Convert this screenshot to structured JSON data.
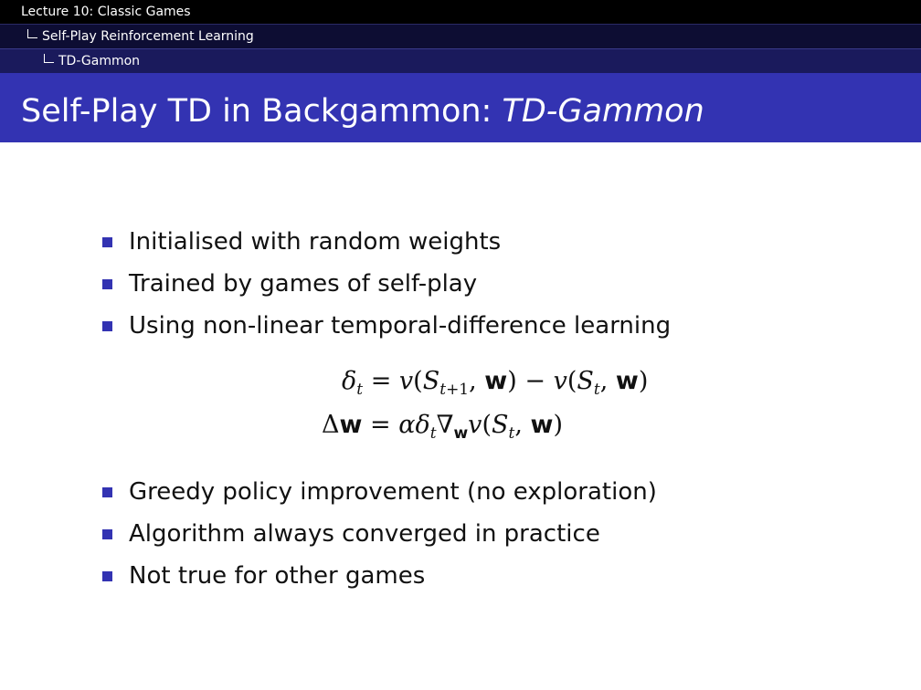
{
  "header": {
    "lecture": "Lecture 10: Classic Games",
    "section": "Self-Play Reinforcement Learning",
    "subsection": "TD-Gammon"
  },
  "slide": {
    "title_main": "Self-Play TD in Backgammon: ",
    "title_italic": "TD-Gammon",
    "bullets_top": [
      "Initialised with random weights",
      "Trained by games of self-play",
      "Using non-linear temporal-difference learning"
    ],
    "bullets_bottom": [
      "Greedy policy improvement (no exploration)",
      "Algorithm always converged in practice",
      "Not true for other games"
    ]
  },
  "colors": {
    "accent": "#3333b2",
    "nav_dark": "#000000"
  }
}
